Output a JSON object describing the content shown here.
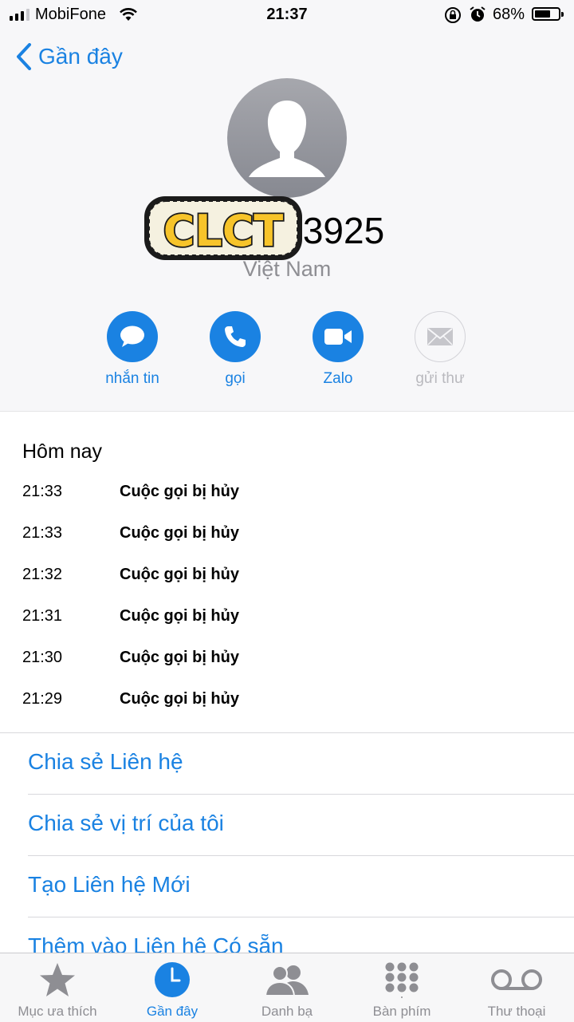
{
  "status_bar": {
    "carrier": "MobiFone",
    "time": "21:37",
    "battery_percent": "68%",
    "battery_level": 0.68
  },
  "nav": {
    "back_label": "Gần đây"
  },
  "contact": {
    "phone_number": "+84 213925",
    "country": "Việt Nam",
    "sticker_text": "CLCT"
  },
  "actions": [
    {
      "label": "nhắn tin",
      "icon": "message-icon",
      "enabled": true
    },
    {
      "label": "gọi",
      "icon": "phone-icon",
      "enabled": true
    },
    {
      "label": "Zalo",
      "icon": "video-icon",
      "enabled": true
    },
    {
      "label": "gửi thư",
      "icon": "mail-icon",
      "enabled": false
    }
  ],
  "history": {
    "title": "Hôm nay",
    "entries": [
      {
        "time": "21:33",
        "status": "Cuộc gọi bị hủy"
      },
      {
        "time": "21:33",
        "status": "Cuộc gọi bị hủy"
      },
      {
        "time": "21:32",
        "status": "Cuộc gọi bị hủy"
      },
      {
        "time": "21:31",
        "status": "Cuộc gọi bị hủy"
      },
      {
        "time": "21:30",
        "status": "Cuộc gọi bị hủy"
      },
      {
        "time": "21:29",
        "status": "Cuộc gọi bị hủy"
      }
    ]
  },
  "links": [
    {
      "label": "Chia sẻ Liên hệ"
    },
    {
      "label": "Chia sẻ vị trí của tôi"
    },
    {
      "label": "Tạo Liên hệ Mới"
    },
    {
      "label": "Thêm vào Liên hệ Có sẵn"
    }
  ],
  "tabs": [
    {
      "label": "Mục ưa thích",
      "icon": "star-icon",
      "active": false
    },
    {
      "label": "Gần đây",
      "icon": "clock-icon",
      "active": true
    },
    {
      "label": "Danh bạ",
      "icon": "contacts-icon",
      "active": false
    },
    {
      "label": "Bàn phím",
      "icon": "keypad-icon",
      "active": false
    },
    {
      "label": "Thư thoại",
      "icon": "voicemail-icon",
      "active": false
    }
  ],
  "colors": {
    "accent": "#1a82e2",
    "secondary_text": "#8e8e93",
    "background": "#f7f7f9"
  }
}
